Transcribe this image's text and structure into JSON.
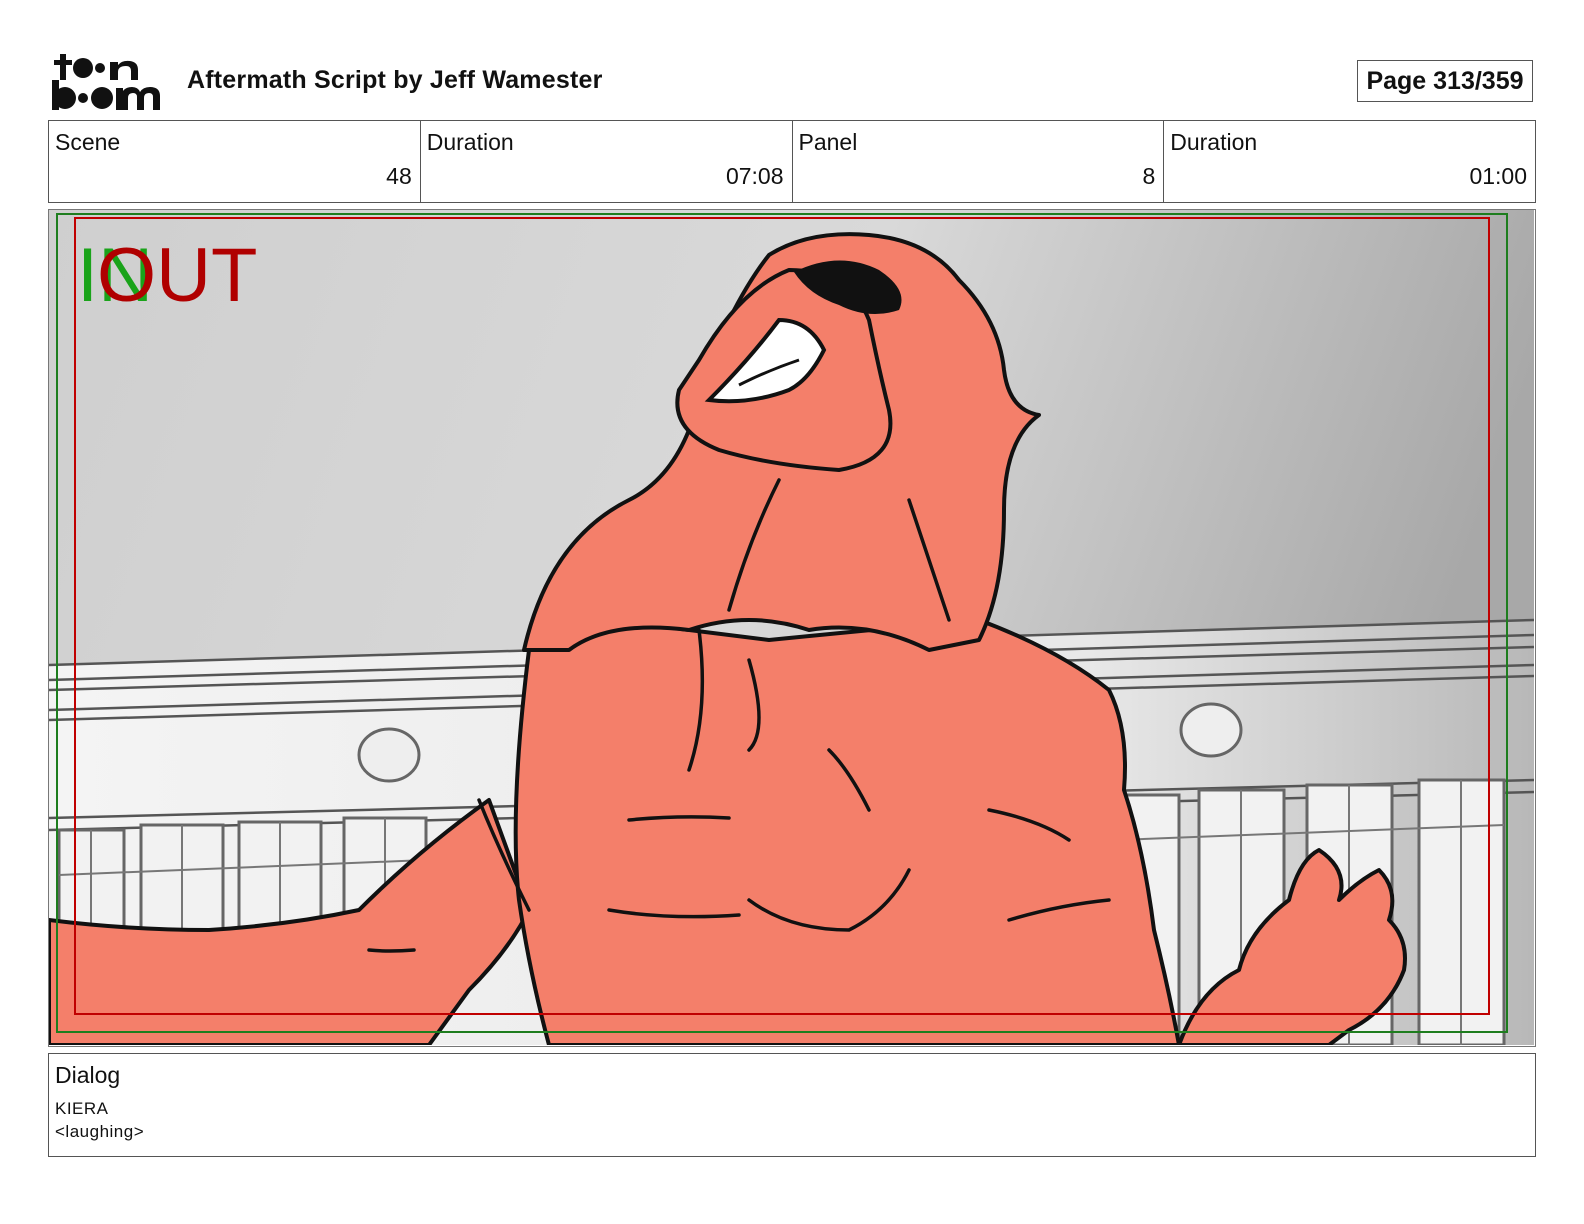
{
  "header": {
    "logo_text": "toon boom",
    "title": "Aftermath  Script by Jeff Wamester",
    "page": "Page 313/359"
  },
  "info": {
    "scene_label": "Scene",
    "scene_value": "48",
    "scene_duration_label": "Duration",
    "scene_duration_value": "07:08",
    "panel_label": "Panel",
    "panel_value": "8",
    "panel_duration_label": "Duration",
    "panel_duration_value": "01:00"
  },
  "frame": {
    "in_marker": "IN",
    "out_marker": "OUT",
    "colors": {
      "in": "#1aa31a",
      "out": "#b00000",
      "character": "#f47f6a"
    }
  },
  "dialog": {
    "label": "Dialog",
    "speaker": "KIERA",
    "line": "<laughing>"
  }
}
